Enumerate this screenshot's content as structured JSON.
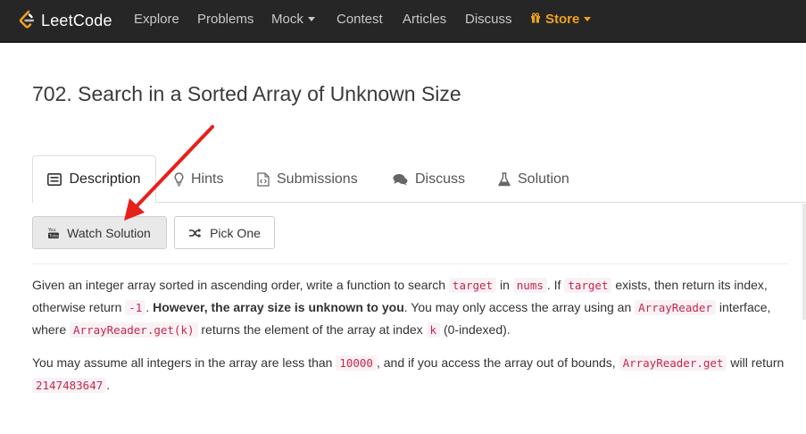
{
  "nav": {
    "brand": "LeetCode",
    "items": [
      "Explore",
      "Problems",
      "Mock",
      "Contest",
      "Articles",
      "Discuss"
    ],
    "store": "Store"
  },
  "problem": {
    "number": "702.",
    "title": "Search in a Sorted Array of Unknown Size"
  },
  "tabs": [
    {
      "label": "Description",
      "icon": "list-icon",
      "active": true
    },
    {
      "label": "Hints",
      "icon": "lightbulb-icon"
    },
    {
      "label": "Submissions",
      "icon": "code-file-icon"
    },
    {
      "label": "Discuss",
      "icon": "comments-icon"
    },
    {
      "label": "Solution",
      "icon": "flask-icon"
    }
  ],
  "buttons": {
    "watch_solution": "Watch Solution",
    "pick_one": "Pick One"
  },
  "description": {
    "p1": {
      "t1": "Given an integer array sorted in ascending order, write a function to search ",
      "c1": "target",
      "t2": " in ",
      "c2": "nums",
      "t3": ".  If ",
      "c3": "target",
      "t4": " exists, then return its index, otherwise return ",
      "c4": "-1",
      "t5": ". ",
      "b1": "However, the array size is unknown to you",
      "t6": ". You may only access the array using an ",
      "c5": "ArrayReader",
      "t7": " interface, where ",
      "c6": "ArrayReader.get(k)",
      "t8": " returns the element of the array at index ",
      "c7": "k",
      "t9": " (0-indexed)."
    },
    "p2": {
      "t1": "You may assume all integers in the array are less than ",
      "c1": "10000",
      "t2": ", and if you access the array out of bounds, ",
      "c2": "ArrayReader.get",
      "t3": " will return ",
      "c3": "2147483647",
      "t4": "."
    }
  },
  "colors": {
    "navbar": "#262626",
    "store": "#f0a020",
    "code_text": "#c7254e",
    "code_bg": "#f9f2f4",
    "arrow": "#e8201a"
  }
}
